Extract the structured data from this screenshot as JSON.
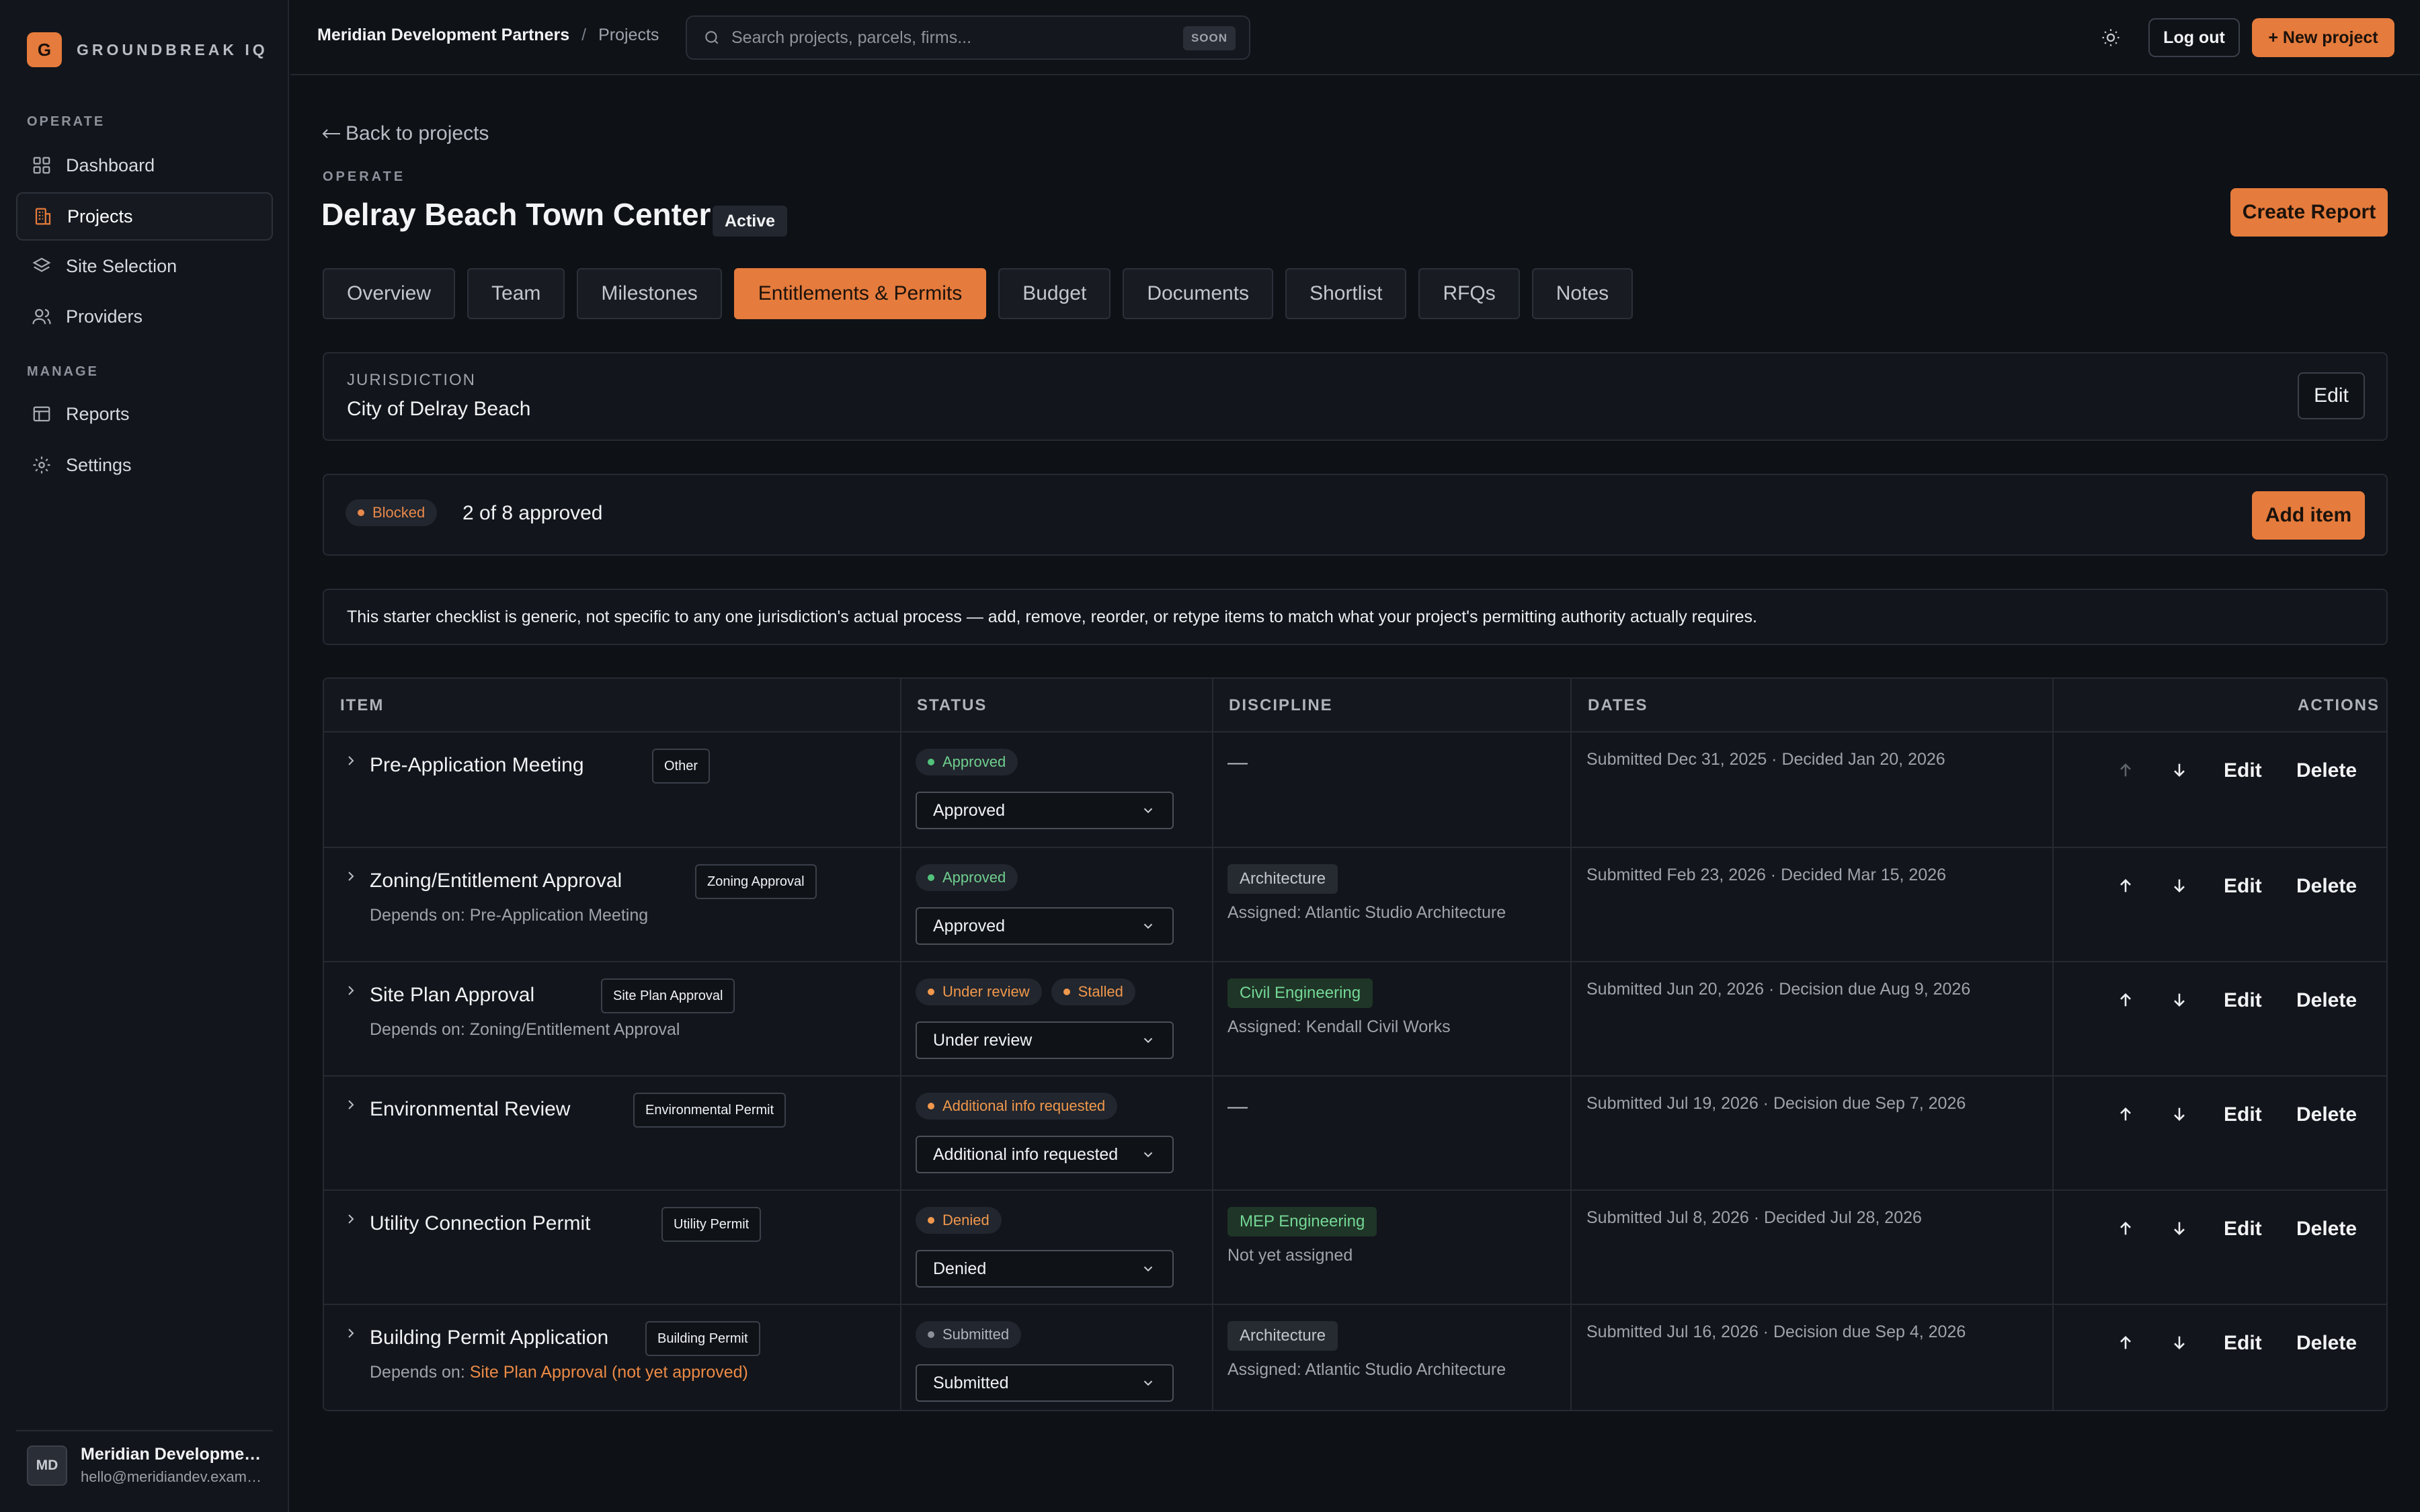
{
  "brand": {
    "logo_letter": "G",
    "name": "GROUNDBREAK IQ",
    "accent": "#e57b3c"
  },
  "sidebar": {
    "operate_label": "OPERATE",
    "manage_label": "MANAGE",
    "operate_items": [
      {
        "label": "Dashboard",
        "icon": "grid-icon"
      },
      {
        "label": "Projects",
        "icon": "building-icon",
        "active": true
      },
      {
        "label": "Site Selection",
        "icon": "layers-icon"
      },
      {
        "label": "Providers",
        "icon": "users-icon"
      }
    ],
    "manage_items": [
      {
        "label": "Reports",
        "icon": "table-icon"
      },
      {
        "label": "Settings",
        "icon": "gear-icon"
      }
    ],
    "user": {
      "initials": "MD",
      "name": "Meridian Development Partners",
      "email": "hello@meridiandev.example"
    }
  },
  "topbar": {
    "breadcrumb_org": "Meridian Development Partners",
    "breadcrumb_sep": "/",
    "breadcrumb_current": "Projects",
    "search_placeholder": "Search projects, parcels, firms...",
    "search_badge": "SOON",
    "logout_label": "Log out",
    "new_project_label": "+ New project"
  },
  "project": {
    "back_label": "Back to projects",
    "eyebrow": "OPERATE",
    "title": "Delray Beach Town Center",
    "status_badge": "Active",
    "create_report_label": "Create Report",
    "tabs": [
      "Overview",
      "Team",
      "Milestones",
      "Entitlements & Permits",
      "Budget",
      "Documents",
      "Shortlist",
      "RFQs",
      "Notes"
    ],
    "active_tab": "Entitlements & Permits"
  },
  "jurisdiction": {
    "label": "JURISDICTION",
    "value": "City of Delray Beach",
    "edit_label": "Edit"
  },
  "summary": {
    "status": "Blocked",
    "approved_text": "2 of 8 approved",
    "add_label": "Add item"
  },
  "notice": "This starter checklist is generic, not specific to any one jurisdiction's actual process — add, remove, reorder, or retype items to match what your project's permitting authority actually requires.",
  "table": {
    "headers": {
      "item": "ITEM",
      "status": "STATUS",
      "discipline": "DISCIPLINE",
      "dates": "DATES",
      "actions": "ACTIONS"
    },
    "edit_label": "Edit",
    "delete_label": "Delete",
    "rows": [
      {
        "name": "Pre-Application Meeting",
        "type": "Other",
        "depends_prefix": "",
        "depends_on": "",
        "statuses": [
          "Approved"
        ],
        "select_value": "Approved",
        "discipline": "—",
        "assigned": "",
        "dates": "Submitted Dec 31, 2025 · Decided Jan 20, 2026"
      },
      {
        "name": "Zoning/Entitlement Approval",
        "type": "Zoning Approval",
        "depends_prefix": "Depends on: ",
        "depends_on": "Pre-Application Meeting",
        "statuses": [
          "Approved"
        ],
        "select_value": "Approved",
        "discipline": "Architecture",
        "assigned": "Assigned: Atlantic Studio Architecture",
        "dates": "Submitted Feb 23, 2026 · Decided Mar 15, 2026"
      },
      {
        "name": "Site Plan Approval",
        "type": "Site Plan Approval",
        "depends_prefix": "Depends on: ",
        "depends_on": "Zoning/Entitlement Approval",
        "statuses": [
          "Under review",
          "Stalled"
        ],
        "select_value": "Under review",
        "discipline": "Civil Engineering",
        "assigned": "Assigned: Kendall Civil Works",
        "dates": "Submitted Jun 20, 2026 · Decision due Aug 9, 2026"
      },
      {
        "name": "Environmental Review",
        "type": "Environmental Permit",
        "depends_prefix": "",
        "depends_on": "",
        "statuses": [
          "Additional info requested"
        ],
        "select_value": "Additional info requested",
        "discipline": "—",
        "assigned": "",
        "dates": "Submitted Jul 19, 2026 · Decision due Sep 7, 2026"
      },
      {
        "name": "Utility Connection Permit",
        "type": "Utility Permit",
        "depends_prefix": "",
        "depends_on": "",
        "statuses": [
          "Denied"
        ],
        "select_value": "Denied",
        "discipline": "MEP Engineering",
        "assigned": "Not yet assigned",
        "dates": "Submitted Jul 8, 2026 · Decided Jul 28, 2026"
      },
      {
        "name": "Building Permit Application",
        "type": "Building Permit",
        "depends_prefix": "Depends on: ",
        "depends_on": "Site Plan Approval (not yet approved)",
        "statuses": [
          "Submitted"
        ],
        "select_value": "Submitted",
        "discipline": "Architecture",
        "assigned": "Assigned: Atlantic Studio Architecture",
        "dates": "Submitted Jul 16, 2026 · Decision due Sep 4, 2026"
      }
    ]
  }
}
